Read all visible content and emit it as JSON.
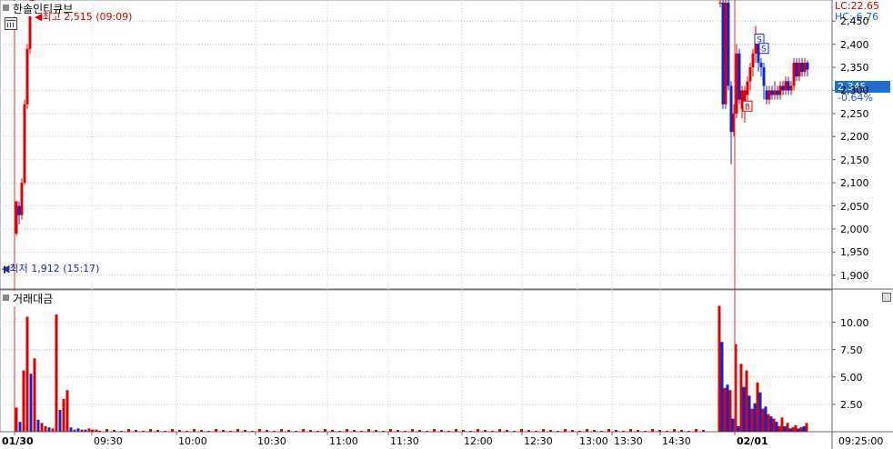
{
  "chart_data": [
    {
      "type": "candlestick",
      "title": "한솔인티큐브",
      "ylim": [
        1870,
        2480
      ],
      "yticks": [
        "2,450",
        "2,400",
        "2,350",
        "2,300",
        "2,250",
        "2,200",
        "2,150",
        "2,100",
        "2,050",
        "2,000",
        "1,950",
        "1,900"
      ],
      "ytick_values": [
        2450,
        2400,
        2350,
        2300,
        2250,
        2200,
        2150,
        2100,
        2050,
        2000,
        1950,
        1900
      ],
      "lc_label": "LC:22.65",
      "hc_label": "HC:-6.76",
      "current_price_label": "2,345",
      "current_change_label": "-0.64%",
      "high_label": "최고 2,515 (09:09)",
      "low_label": "최저 1,912 (15:17)",
      "high_value": 2515,
      "low_value": 1912,
      "current_value": 2345,
      "buy_marker": "B",
      "sell_marker": "S",
      "up_color": "#e00000",
      "down_color": "#0a28d8",
      "session1_bars": [
        [
          1990,
          2060,
          1985,
          2050
        ],
        [
          2050,
          2030,
          2010,
          2060
        ],
        [
          2030,
          2100,
          2020,
          2110
        ],
        [
          2100,
          2270,
          2095,
          2280
        ],
        [
          2270,
          2390,
          2260,
          2400
        ],
        [
          2390,
          2490,
          2380,
          2500
        ],
        [
          2490,
          2515,
          2470,
          2515
        ]
      ],
      "session2_bars": [
        [
          2490,
          2490,
          2480,
          2500
        ],
        [
          2490,
          2270,
          2260,
          2500
        ],
        [
          2270,
          2490,
          2260,
          2500
        ],
        [
          2490,
          2310,
          2300,
          2500
        ],
        [
          2310,
          2210,
          2140,
          2320
        ],
        [
          2210,
          2250,
          2200,
          2270
        ],
        [
          2250,
          2380,
          2240,
          2400
        ],
        [
          2380,
          2280,
          2270,
          2390
        ],
        [
          2260,
          2300,
          2240,
          2310
        ],
        [
          2270,
          2300,
          2230,
          2310
        ],
        [
          2290,
          2320,
          2270,
          2330
        ],
        [
          2320,
          2350,
          2300,
          2360
        ],
        [
          2350,
          2380,
          2330,
          2390
        ],
        [
          2380,
          2410,
          2360,
          2440
        ],
        [
          2400,
          2360,
          2340,
          2420
        ],
        [
          2360,
          2350,
          2330,
          2370
        ],
        [
          2350,
          2310,
          2280,
          2360
        ],
        [
          2300,
          2280,
          2270,
          2310
        ],
        [
          2280,
          2300,
          2270,
          2310
        ],
        [
          2300,
          2290,
          2280,
          2310
        ],
        [
          2290,
          2300,
          2280,
          2320
        ],
        [
          2300,
          2290,
          2280,
          2310
        ],
        [
          2290,
          2310,
          2280,
          2320
        ],
        [
          2310,
          2300,
          2290,
          2320
        ],
        [
          2300,
          2320,
          2290,
          2330
        ],
        [
          2320,
          2300,
          2290,
          2330
        ],
        [
          2300,
          2310,
          2290,
          2320
        ],
        [
          2310,
          2360,
          2300,
          2370
        ],
        [
          2360,
          2330,
          2320,
          2370
        ],
        [
          2330,
          2360,
          2320,
          2370
        ],
        [
          2360,
          2340,
          2330,
          2370
        ],
        [
          2340,
          2360,
          2330,
          2370
        ],
        [
          2360,
          2345,
          2330,
          2365
        ]
      ]
    },
    {
      "type": "bar",
      "title": "거래대금",
      "ylim": [
        0,
        12.2
      ],
      "yticks": [
        "10.00",
        "7.50",
        "5.00",
        "2.50"
      ],
      "ytick_values": [
        10,
        7.5,
        5,
        2.5
      ],
      "session1_values": [
        [
          2.2,
          "up"
        ],
        [
          0.9,
          "down"
        ],
        [
          5.6,
          "up"
        ],
        [
          10.5,
          "up"
        ],
        [
          5.3,
          "down"
        ],
        [
          6.7,
          "up"
        ],
        [
          1.1,
          "down"
        ],
        [
          0.8,
          "up"
        ],
        [
          0.5,
          "up"
        ],
        [
          0.4,
          "down"
        ],
        [
          0.3,
          "up"
        ],
        [
          10.7,
          "up"
        ],
        [
          2.0,
          "down"
        ],
        [
          3.0,
          "up"
        ],
        [
          3.8,
          "up"
        ],
        [
          0.4,
          "down"
        ],
        [
          0.2,
          "up"
        ],
        [
          0.3,
          "down"
        ],
        [
          0.2,
          "up"
        ],
        [
          0.2,
          "down"
        ],
        [
          0.3,
          "up"
        ],
        [
          0.2,
          "down"
        ],
        [
          0.2,
          "up"
        ]
      ],
      "session2_values": [
        [
          11.5,
          "up"
        ],
        [
          8.2,
          "down"
        ],
        [
          4.0,
          "up"
        ],
        [
          4.3,
          "down"
        ],
        [
          3.8,
          "up"
        ],
        [
          1.2,
          "down"
        ],
        [
          8.0,
          "up"
        ],
        [
          0.5,
          "down"
        ],
        [
          6.2,
          "up"
        ],
        [
          4.1,
          "down"
        ],
        [
          5.6,
          "up"
        ],
        [
          3.3,
          "down"
        ],
        [
          2.1,
          "up"
        ],
        [
          2.6,
          "down"
        ],
        [
          4.5,
          "up"
        ],
        [
          3.6,
          "down"
        ],
        [
          2.1,
          "up"
        ],
        [
          2.3,
          "down"
        ],
        [
          1.6,
          "up"
        ],
        [
          1.4,
          "down"
        ],
        [
          1.2,
          "up"
        ],
        [
          0.9,
          "down"
        ],
        [
          0.5,
          "up"
        ],
        [
          1.3,
          "up"
        ],
        [
          0.5,
          "down"
        ],
        [
          0.8,
          "up"
        ],
        [
          0.3,
          "down"
        ],
        [
          0.4,
          "up"
        ],
        [
          0.6,
          "up"
        ],
        [
          0.3,
          "down"
        ],
        [
          0.4,
          "up"
        ],
        [
          0.5,
          "down"
        ],
        [
          0.8,
          "up"
        ]
      ]
    }
  ],
  "x_axis": {
    "labels": [
      "01/30",
      "09:30",
      "10:00",
      "10:30",
      "11:00",
      "11:30",
      "12:00",
      "12:30",
      "13:00",
      "13:30",
      "14:30",
      "02/01",
      "09:25:00"
    ]
  }
}
